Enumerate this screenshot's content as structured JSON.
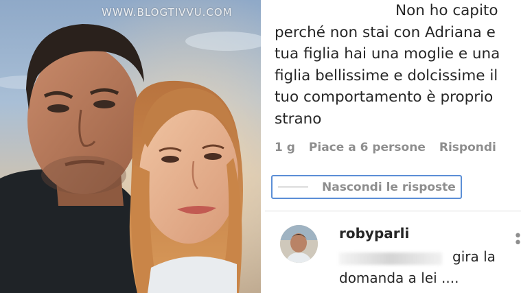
{
  "watermark": "WWW.BLOGTIVVU.COM",
  "comment": {
    "lines": [
      "Non ho capito",
      "perché non stai con Adriana e",
      "tua figlia hai una moglie e una",
      "figlia bellissime e dolcissime il",
      "tuo comportamento è proprio",
      "strano"
    ],
    "time": "1 g",
    "likes": "Piace a 6 persone",
    "reply_label": "Rispondi"
  },
  "replies_toggle": {
    "label": "Nascondi le risposte",
    "border_color": "#5b8ed6"
  },
  "reply": {
    "username": "robyparli",
    "text_line1_visible": "gira la",
    "text_line2": "domanda a lei ....",
    "more_icon": "more-options-icon"
  },
  "colors": {
    "text": "#262626",
    "muted": "#8e8e8e"
  }
}
